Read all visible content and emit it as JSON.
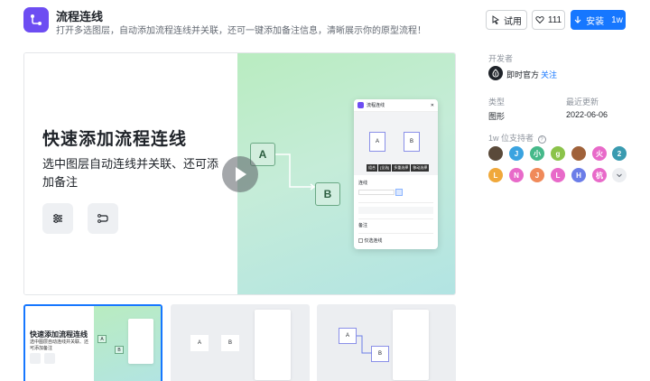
{
  "header": {
    "title": "流程连线",
    "description": "打开多选图层，自动添加流程连线并关联，还可一键添加备注信息，清晰展示你的原型流程！",
    "try_label": "试用",
    "like_count": "111",
    "install_label": "安装",
    "install_count": "1w"
  },
  "preview": {
    "hero_title": "快速添加流程连线",
    "hero_subtitle": "选中图层自动连线并关联、还可添加备注",
    "node_a": "A",
    "node_b": "B",
    "panel": {
      "title": "流程连线",
      "node_a": "A",
      "node_b": "B",
      "toolbar": [
        "组合",
        "[全选]",
        "多重选择",
        "移动选择"
      ],
      "section_line": "连线",
      "section_note": "备注",
      "bottom_option": "仅选连线"
    }
  },
  "thumbnails": [
    {
      "title": "快速添加流程连线",
      "subtitle": "选中图层自动连线并关联、还可添加备注",
      "node_a": "A",
      "node_b": "B"
    },
    {
      "node_a": "A",
      "node_b": "B"
    },
    {
      "node_a": "A",
      "node_b": "B"
    }
  ],
  "sidebar": {
    "developer_label": "开发者",
    "developer_name": "即时官方",
    "follow_label": "关注",
    "category_label": "类型",
    "category_value": "图形",
    "updated_label": "最近更新",
    "updated_value": "2022-06-06",
    "supporters_label": "1w 位支持者",
    "supporters": [
      {
        "text": "",
        "color": "#5a4a3a"
      },
      {
        "text": "J",
        "color": "#3aa3e0"
      },
      {
        "text": "小",
        "color": "#46b98a"
      },
      {
        "text": "g",
        "color": "#8bc34a"
      },
      {
        "text": "",
        "color": "#a0623a"
      },
      {
        "text": "火",
        "color": "#e86ac9"
      },
      {
        "text": "2",
        "color": "#3a9bb0"
      },
      {
        "text": "L",
        "color": "#f0a83a"
      },
      {
        "text": "N",
        "color": "#e86ac9"
      },
      {
        "text": "J",
        "color": "#f08a5a"
      },
      {
        "text": "L",
        "color": "#e86ac9"
      },
      {
        "text": "H",
        "color": "#6b7de8"
      },
      {
        "text": "杭",
        "color": "#e86ac9"
      }
    ]
  },
  "colors": {
    "accent": "#1677ff",
    "brand": "#6d4df2"
  }
}
